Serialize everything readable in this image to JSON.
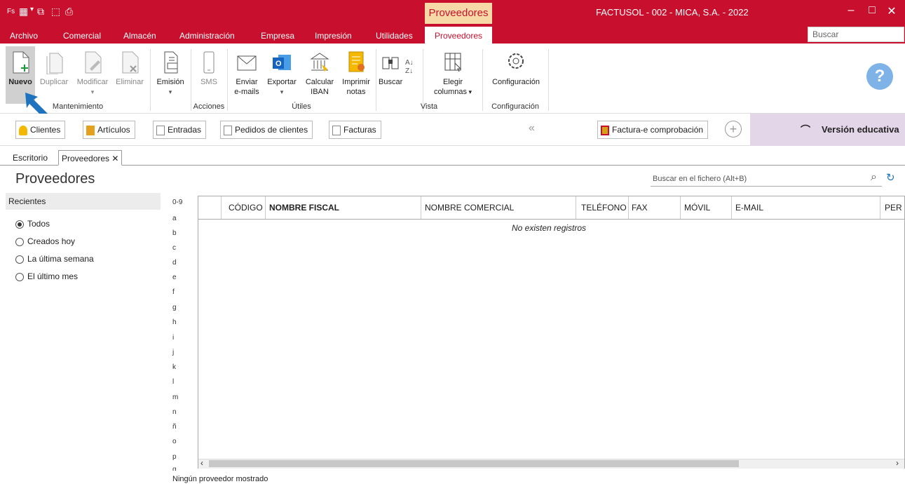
{
  "titlebar": {
    "quick_access": [
      "Fs",
      "▦",
      "⧉",
      "⬚",
      "⎙"
    ],
    "context_title": "Proveedores",
    "app_title": "FACTUSOL - 002 - MICA, S.A. - 2022"
  },
  "menu": [
    "Archivo",
    "Comercial",
    "Almacén",
    "Administración",
    "Empresa",
    "Impresión",
    "Utilidades",
    "Proveedores"
  ],
  "search_placeholder": "Buscar",
  "ribbon": {
    "buttons": [
      "Nuevo",
      "Duplicar",
      "Modificar",
      "Eliminar",
      "Emisión",
      "SMS",
      "Enviar",
      "e-mails",
      "Exportar",
      "Calcular",
      "IBAN",
      "Imprimir",
      "notas",
      "Buscar",
      "Elegir",
      "columnas",
      "Configuración"
    ],
    "groups": [
      "Mantenimiento",
      "Acciones",
      "Útiles",
      "Vista",
      "Configuración"
    ]
  },
  "quickbar": {
    "buttons": [
      "Clientes",
      "Artículos",
      "Entradas",
      "Pedidos de clientes",
      "Facturas"
    ],
    "chevron": "«",
    "factura": "Factura-e comprobación",
    "edu": "Versión educativa"
  },
  "tabs": [
    "Escritorio",
    "Proveedores"
  ],
  "page": {
    "title": "Proveedores",
    "search_placeholder": "Buscar en el fichero (Alt+B)"
  },
  "recientes": {
    "title": "Recientes",
    "options": [
      "Todos",
      "Creados hoy",
      "La última semana",
      "El último mes"
    ]
  },
  "letters": [
    "0-9",
    "a",
    "b",
    "c",
    "d",
    "e",
    "f",
    "g",
    "h",
    "i",
    "j",
    "k",
    "l",
    "m",
    "n",
    "ñ",
    "o",
    "p",
    "q"
  ],
  "table": {
    "columns": [
      "CÓDIGO",
      "NOMBRE FISCAL",
      "NOMBRE COMERCIAL",
      "TELÉFONO",
      "FAX",
      "MÓVIL",
      "E-MAIL",
      "PER"
    ],
    "empty": "No existen registros"
  },
  "footer": "Ningún proveedor mostrado",
  "colors": {
    "brand": "#c8102e",
    "context_tab": "#f7d9a8",
    "edu_bg": "#e4d6e9",
    "pointer": "#1e73be"
  }
}
